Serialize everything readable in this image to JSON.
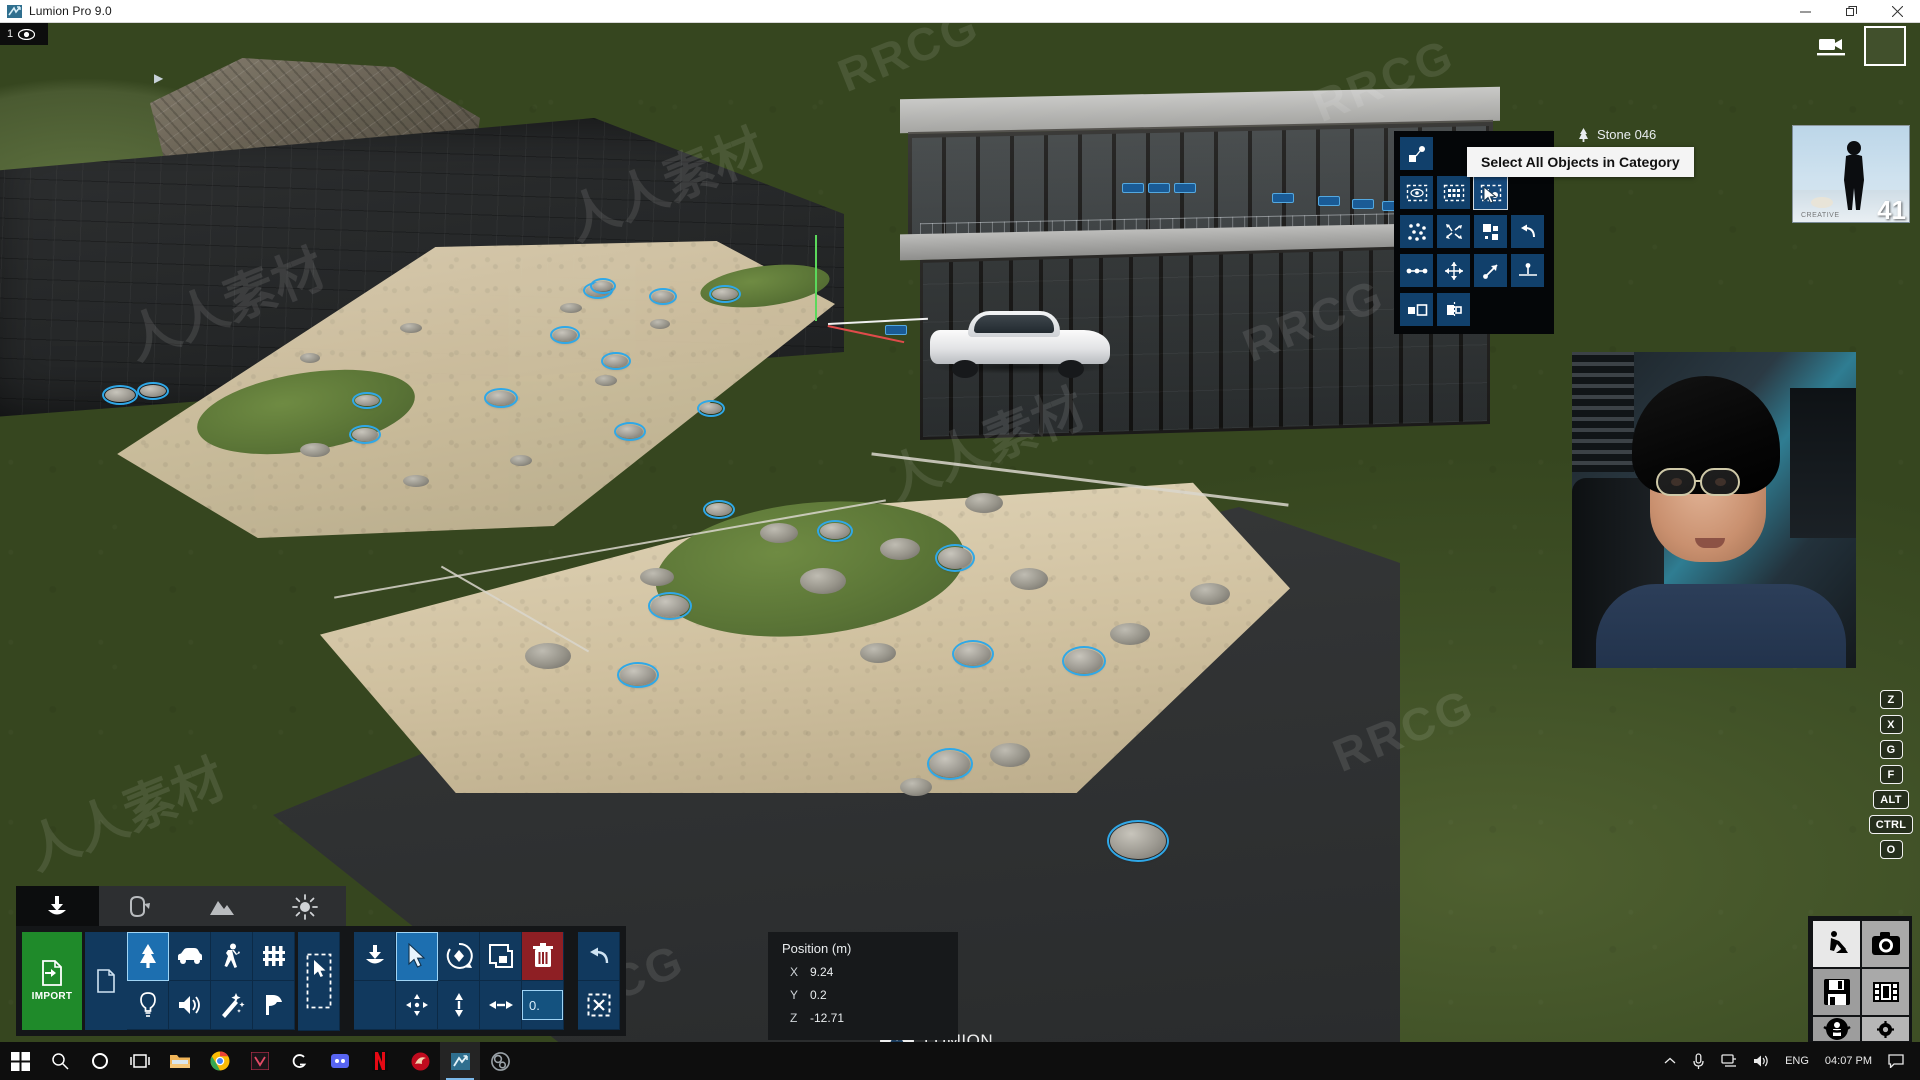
{
  "window": {
    "title": "Lumion Pro 9.0",
    "app_icon": "lumion-icon",
    "minimize": "—",
    "maximize": "❐",
    "close": "✕"
  },
  "viewport": {
    "layer_tab": {
      "number": "1",
      "icon": "eye-icon"
    },
    "top_right": {
      "camera_icon": "video-camera-icon",
      "frame_icon": "viewport-frame-icon"
    },
    "thumbnail": {
      "count": "41",
      "watermark": "CREATIVE",
      "person_icon": "person-silhouette-icon"
    },
    "gizmo": {
      "green_axis": "#5bd85b",
      "red_axis": "#e04b4b",
      "white_axis": "#f0f0f0"
    },
    "selection_color": "#2fa8e8"
  },
  "context_menu": {
    "tooltip": "Select All Objects in Category",
    "object_label": "Stone 046",
    "object_icon": "tree-icon",
    "rows": [
      [
        {
          "name": "move-to-layer-icon",
          "highlight": false
        }
      ],
      [
        {
          "name": "hide-objects-icon",
          "highlight": false
        },
        {
          "name": "select-all-icon",
          "highlight": false
        },
        {
          "name": "select-all-in-category-icon",
          "highlight": true
        }
      ],
      [
        {
          "name": "scatter-icon",
          "highlight": false
        },
        {
          "name": "random-rotate-icon",
          "highlight": false
        },
        {
          "name": "random-size-icon",
          "highlight": false
        },
        {
          "name": "undo-transform-icon",
          "highlight": false
        }
      ],
      [
        {
          "name": "space-evenly-icon",
          "highlight": false
        },
        {
          "name": "align-center-icon",
          "highlight": false
        },
        {
          "name": "align-slope-icon",
          "highlight": false
        },
        {
          "name": "place-on-ground-icon",
          "highlight": false
        }
      ],
      [
        {
          "name": "size-match-icon",
          "highlight": false
        },
        {
          "name": "mirror-icon",
          "highlight": false
        }
      ]
    ],
    "expand_arrow": "▶"
  },
  "bottom_tabs": [
    {
      "label": "Objects",
      "icon": "objects-icon",
      "active": true
    },
    {
      "label": "Materials",
      "icon": "paint-bucket-icon",
      "active": false
    },
    {
      "label": "Landscape",
      "icon": "mountain-icon",
      "active": false
    },
    {
      "label": "Weather",
      "icon": "sun-icon",
      "active": false
    }
  ],
  "toolbar": {
    "import_label": "IMPORT",
    "import_icon": "import-icon",
    "library_icon": "file-icon",
    "categories": [
      {
        "name": "nature",
        "icon": "tree-icon",
        "active": true
      },
      {
        "name": "lights",
        "icon": "bulb-icon",
        "active": false
      },
      {
        "name": "transport",
        "icon": "car-icon",
        "active": false
      },
      {
        "name": "sound",
        "icon": "speaker-icon",
        "active": false
      },
      {
        "name": "people",
        "icon": "person-icon",
        "active": false
      },
      {
        "name": "effects",
        "icon": "wand-icon",
        "active": false
      },
      {
        "name": "fences",
        "icon": "fence-icon",
        "active": false
      },
      {
        "name": "indoor",
        "icon": "chair-icon",
        "active": false
      }
    ],
    "select_rect_icon": "selection-rectangle-icon",
    "actions": [
      {
        "name": "place",
        "icon": "place-object-icon",
        "active": false,
        "style": "normal"
      },
      {
        "name": "select",
        "icon": "select-arrow-icon",
        "active": true,
        "style": "normal"
      },
      {
        "name": "rotate",
        "icon": "rotate-icon",
        "active": false,
        "style": "normal"
      },
      {
        "name": "scale",
        "icon": "scale-icon",
        "active": false,
        "style": "normal"
      },
      {
        "name": "delete",
        "icon": "trash-icon",
        "active": false,
        "style": "red"
      }
    ],
    "transform_row": [
      {
        "name": "move-xy",
        "icon": "move-4way-icon"
      },
      {
        "name": "move-up",
        "icon": "move-vertical-icon"
      },
      {
        "name": "size",
        "icon": "move-horizontal-icon"
      }
    ],
    "number_input": {
      "value": "0.",
      "name": "size-value-input"
    },
    "undo_icon": "undo-icon",
    "deselect_icon": "deselect-icon"
  },
  "position_panel": {
    "title": "Position (m)",
    "rows": [
      {
        "axis": "X",
        "value": "9.24"
      },
      {
        "axis": "Y",
        "value": "0.2"
      },
      {
        "axis": "Z",
        "value": "-12.71"
      }
    ]
  },
  "key_hints": [
    "Z",
    "X",
    "G",
    "F",
    "ALT",
    "CTRL",
    "O"
  ],
  "mode_panel": [
    {
      "name": "build-mode",
      "icon": "construction-worker-icon",
      "active": true
    },
    {
      "name": "photo-mode",
      "icon": "camera-icon",
      "active": false
    },
    {
      "name": "save-project",
      "icon": "floppy-disk-icon",
      "active": false
    },
    {
      "name": "movie-mode",
      "icon": "film-strip-icon",
      "active": false
    },
    {
      "name": "panorama-mode",
      "icon": "panorama-icon",
      "active": false
    },
    {
      "name": "settings",
      "icon": "gear-icon",
      "active": false
    },
    {
      "name": "help",
      "icon": "question-mark-icon",
      "label": "?",
      "active": false
    }
  ],
  "branding": {
    "logo_text": "LUMION",
    "logo_icon": "lumion-logo-icon"
  },
  "watermarks": {
    "cn": "人人素材",
    "en": "RRCG"
  },
  "taskbar": {
    "items": [
      {
        "name": "start-button",
        "icon": "windows-logo-icon"
      },
      {
        "name": "search-button",
        "icon": "search-icon"
      },
      {
        "name": "cortana-button",
        "icon": "cortana-circle-icon"
      },
      {
        "name": "task-view-button",
        "icon": "task-view-icon"
      },
      {
        "name": "file-explorer",
        "icon": "folder-icon"
      },
      {
        "name": "chrome",
        "icon": "chrome-icon"
      },
      {
        "name": "vivaldi",
        "icon": "vivaldi-icon"
      },
      {
        "name": "logitech-g",
        "icon": "logitech-g-icon"
      },
      {
        "name": "discord",
        "icon": "discord-icon"
      },
      {
        "name": "netflix",
        "icon": "netflix-icon"
      },
      {
        "name": "msi-center",
        "icon": "msi-dragon-icon"
      },
      {
        "name": "lumion",
        "icon": "lumion-icon",
        "active": true
      },
      {
        "name": "obs-studio",
        "icon": "obs-icon"
      }
    ],
    "tray": {
      "chevron": "⌃",
      "mic_icon": "microphone-icon",
      "network_icon": "network-icon",
      "volume_icon": "speaker-icon",
      "language": "ENG",
      "time": "04:07 PM",
      "notification_icon": "notification-icon"
    }
  }
}
